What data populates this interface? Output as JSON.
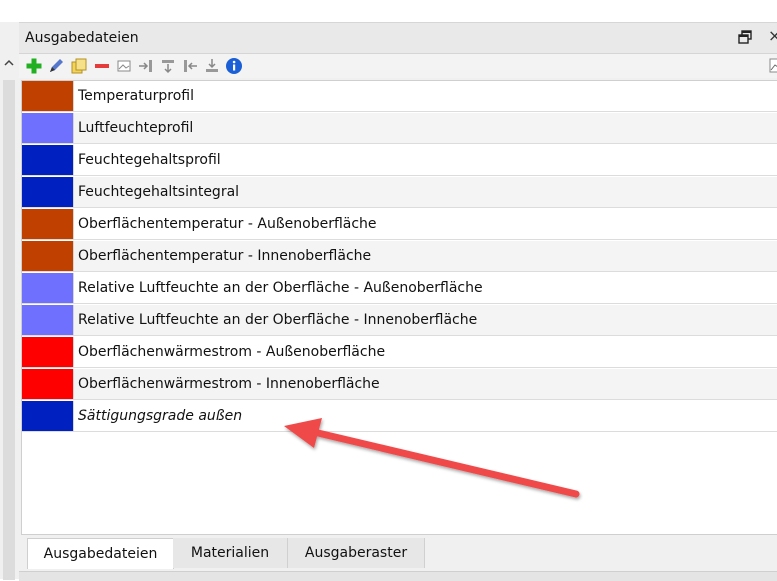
{
  "panel": {
    "title": "Ausgabedateien"
  },
  "toolbar": {
    "icons": [
      "add-icon",
      "edit-icon",
      "copy-icon",
      "remove-icon",
      "image-icon",
      "move-right-icon",
      "filter-icon",
      "move-left-icon",
      "sort-icon",
      "info-icon",
      "chart-icon"
    ]
  },
  "outputs": [
    {
      "label": "Temperaturprofil",
      "color": "#C04000"
    },
    {
      "label": "Luftfeuchteprofil",
      "color": "#7070FF"
    },
    {
      "label": "Feuchtegehaltsprofil",
      "color": "#0020C0"
    },
    {
      "label": "Feuchtegehaltsintegral",
      "color": "#0020C0"
    },
    {
      "label": "Oberflächentemperatur - Außenoberfläche",
      "color": "#C04000"
    },
    {
      "label": "Oberflächentemperatur - Innenoberfläche",
      "color": "#C04000"
    },
    {
      "label": "Relative Luftfeuchte an der Oberfläche - Außenoberfläche",
      "color": "#7070FF"
    },
    {
      "label": "Relative Luftfeuchte an der Oberfläche - Innenoberfläche",
      "color": "#7070FF"
    },
    {
      "label": "Oberflächenwärmestrom - Außenoberfläche",
      "color": "#FF0000"
    },
    {
      "label": "Oberflächenwärmestrom - Innenoberfläche",
      "color": "#FF0000"
    },
    {
      "label": "Sättigungsgrade außen",
      "color": "#0020C0",
      "italic": true
    }
  ],
  "tabs": [
    {
      "label": "Ausgabedateien",
      "active": true
    },
    {
      "label": "Materialien",
      "active": false
    },
    {
      "label": "Ausgaberaster",
      "active": false
    }
  ],
  "annotation": {
    "color": "#F04848"
  }
}
